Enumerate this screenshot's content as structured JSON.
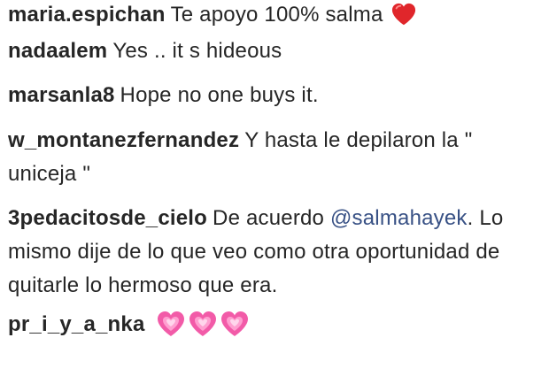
{
  "comments": [
    {
      "username": "maria.espichan",
      "text": "Te apoyo 100% salma",
      "emoji": "red-heart"
    },
    {
      "username": "nadaalem",
      "text": "Yes .. it s hideous"
    },
    {
      "username": "marsanla8",
      "text": "Hope no one buys it."
    },
    {
      "username": "w_montanezfernandez",
      "text": "Y hasta le depilaron la \" uniceja \""
    },
    {
      "username": "3pedacitosde_cielo",
      "text_before": "De acuerdo",
      "mention": "@salmahayek",
      "text_after": ". Lo mismo dije de lo que veo como otra oportunidad de quitarle lo hermoso que era."
    },
    {
      "username": "pr_i_y_a_nka",
      "emoji": "pink-heart",
      "emoji_count": 3
    }
  ],
  "colors": {
    "text": "#262626",
    "mention": "#385185",
    "red_heart": "#e0262b",
    "pink_heart": "#f25ba8"
  }
}
